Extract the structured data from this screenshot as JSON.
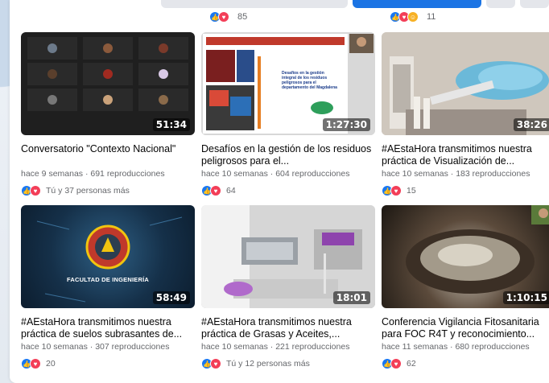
{
  "top_strip": {
    "items": [
      {
        "reactions": [
          "like",
          "love"
        ],
        "count": "85"
      },
      {
        "reactions": [
          "like",
          "love",
          "haha"
        ],
        "count": "11"
      }
    ]
  },
  "colors": {
    "like": "#1877f2",
    "love": "#f33e58",
    "haha": "#f7b125",
    "accent": "#1b74e4"
  },
  "videos": [
    {
      "title": "Conversatorio \"Contexto Nacional\"",
      "meta": "hace 9 semanas · 691 reproducciones",
      "duration": "51:34",
      "reactions": [
        "like",
        "love"
      ],
      "reaction_count": "Tú y 37 personas más"
    },
    {
      "title": "Desafíos en la gestión de los residuos peligrosos para el...",
      "meta": "hace 10 semanas · 604 reproducciones",
      "duration": "1:27:30",
      "reactions": [
        "like",
        "love"
      ],
      "reaction_count": "64",
      "slide_text": "Desafíos en la gestión integral de los residuos peligrosos para el departamento del Magdalena"
    },
    {
      "title": "#AEstaHora transmitimos nuestra práctica de Visualización de...",
      "meta": "hace 10 semanas · 183 reproducciones",
      "duration": "38:26",
      "reactions": [
        "like",
        "love"
      ],
      "reaction_count": "15"
    },
    {
      "title": "#AEstaHora transmitimos nuestra práctica de suelos subrasantes de...",
      "meta": "hace 10 semanas · 307 reproducciones",
      "duration": "58:49",
      "reactions": [
        "like",
        "love"
      ],
      "reaction_count": "20",
      "banner_text": "FACULTAD DE INGENIERÍA"
    },
    {
      "title": "#AEstaHora transmitimos nuestra práctica de Grasas y Aceites,...",
      "meta": "hace 10 semanas · 221 reproducciones",
      "duration": "18:01",
      "reactions": [
        "like",
        "love"
      ],
      "reaction_count": "Tú y 12 personas más"
    },
    {
      "title": "Conferencia Vigilancia Fitosanitaria para FOC R4T y reconocimiento...",
      "meta": "hace 11 semanas · 680 reproducciones",
      "duration": "1:10:15",
      "reactions": [
        "like",
        "love"
      ],
      "reaction_count": "62"
    }
  ]
}
